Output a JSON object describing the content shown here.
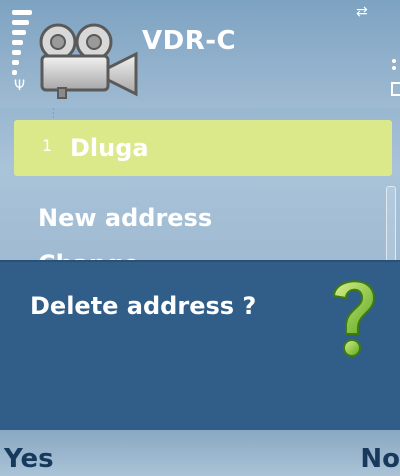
{
  "status": {
    "title": "VDR-C",
    "icons": [
      "signal-strength-icon",
      "antenna-icon",
      "video-camera-icon",
      "connectivity-icon",
      "battery-icon"
    ]
  },
  "list": {
    "items": [
      {
        "index": "1",
        "label": "Dluga",
        "selected": true
      },
      {
        "label": "New address"
      },
      {
        "label": "Change"
      }
    ]
  },
  "dialog": {
    "message": "Delete address ?",
    "icon": "question-mark-icon"
  },
  "softkeys": {
    "left": "Yes",
    "right": "No"
  },
  "colors": {
    "highlight": "#dbe98a",
    "dialog_bg": "#305e88",
    "question_mark": "#9ad13a"
  }
}
